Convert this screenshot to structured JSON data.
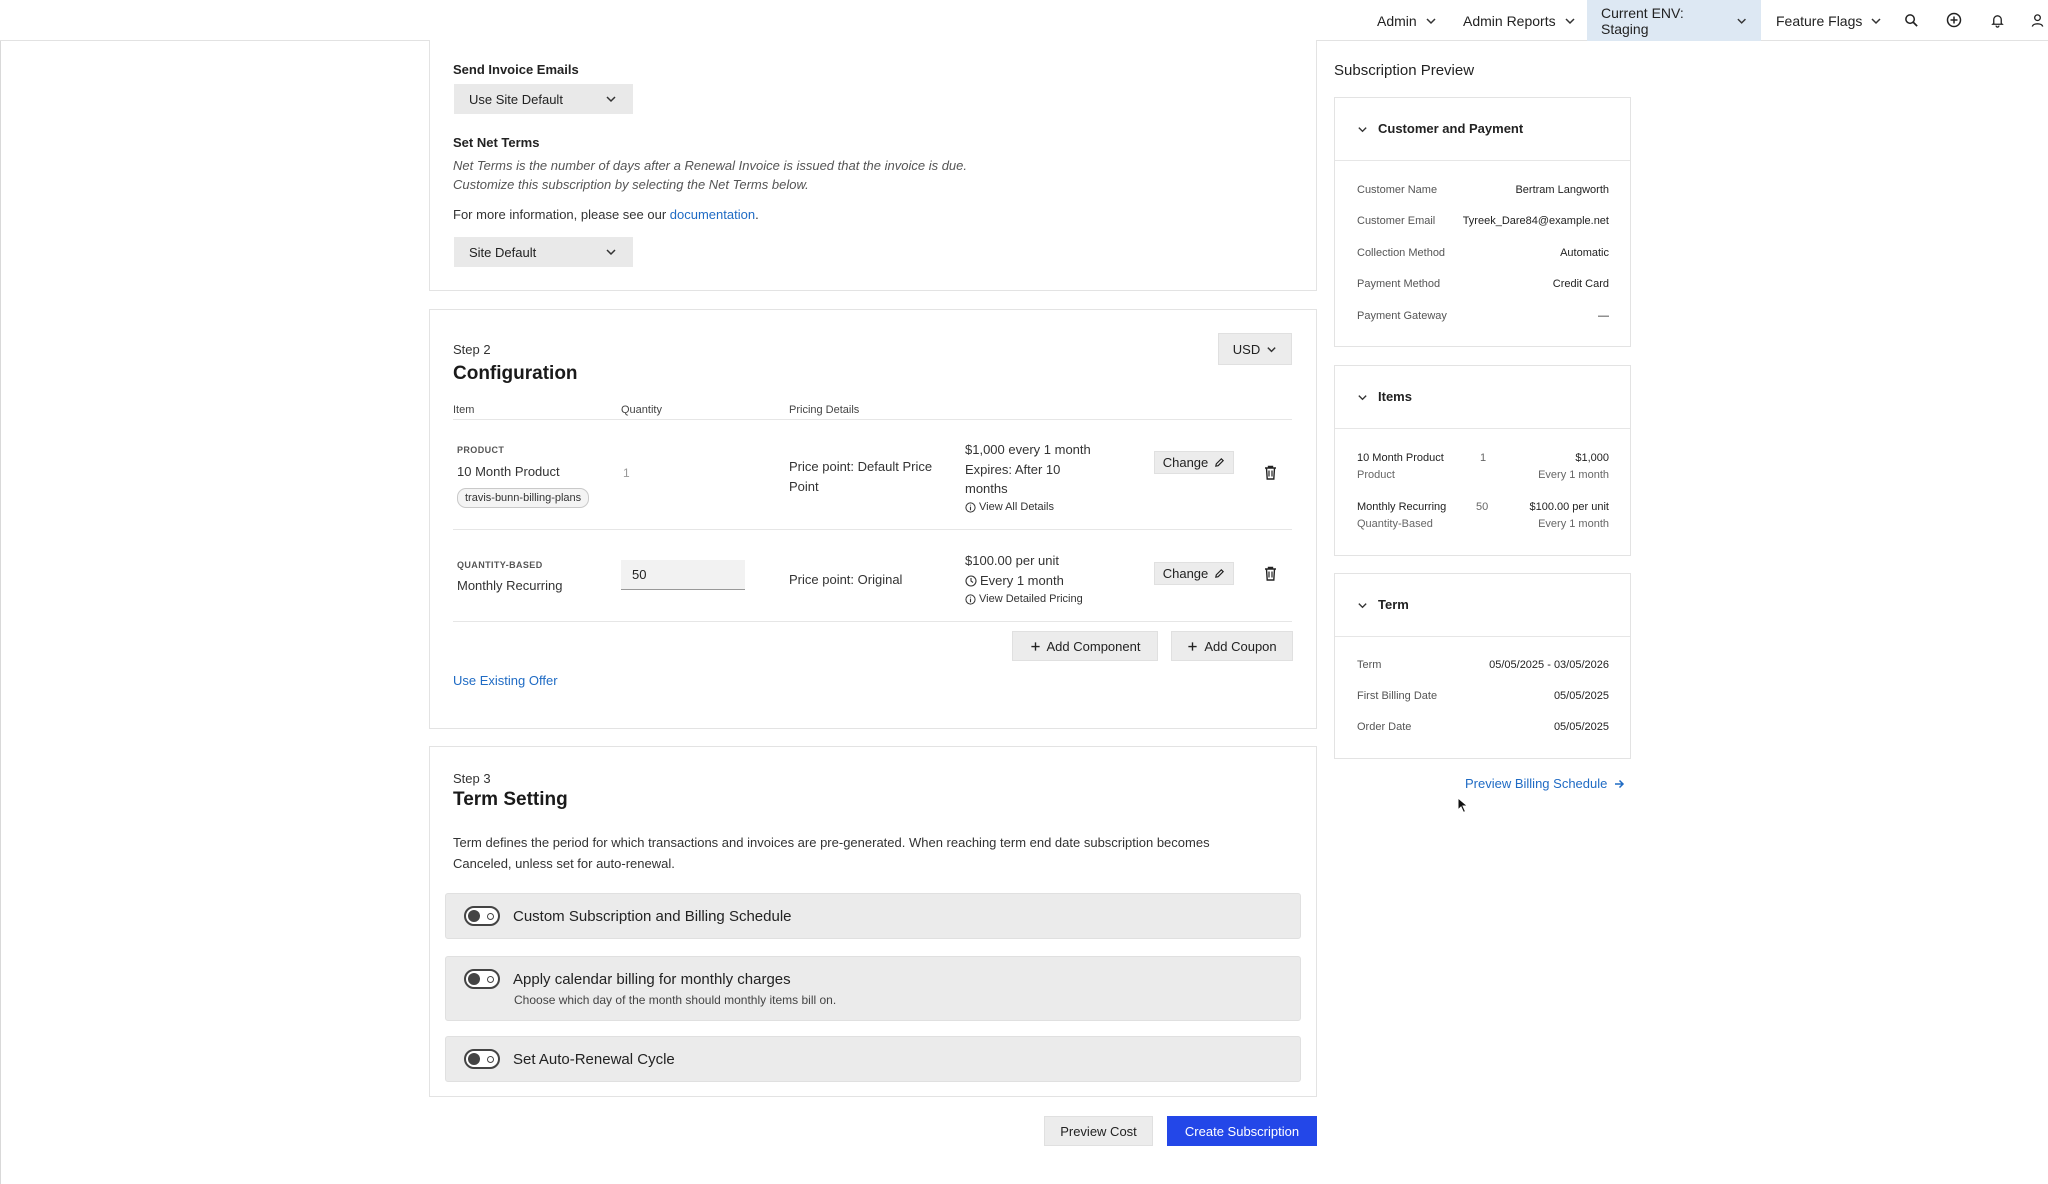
{
  "nav": {
    "admin": "Admin",
    "admin_reports": "Admin Reports",
    "env": "Current ENV: Staging",
    "feature_flags": "Feature Flags"
  },
  "billing": {
    "send_invoice_label": "Send Invoice Emails",
    "send_invoice_value": "Use Site Default",
    "net_terms_label": "Set Net Terms",
    "net_terms_desc_1": "Net Terms is the number of days after a Renewal Invoice is issued that the invoice is due.",
    "net_terms_desc_2": "Customize this subscription by selecting the Net Terms below.",
    "more_info_prefix": "For more information, please see our",
    "documentation_link": "documentation",
    "more_info_suffix": ".",
    "net_terms_value": "Site Default"
  },
  "config": {
    "step": "Step 2",
    "title": "Configuration",
    "currency": "USD",
    "col_item": "Item",
    "col_quantity": "Quantity",
    "col_pricing": "Pricing Details",
    "row1": {
      "type": "PRODUCT",
      "name": "10 Month Product",
      "tag": "travis-bunn-billing-plans",
      "quantity": "1",
      "price_point_1": "Price point: Default Price",
      "price_point_2": "Point",
      "price_1": "$1,000 every 1 month",
      "expires_1": "Expires: After 10",
      "expires_2": "months",
      "details_link": "View All Details",
      "change": "Change"
    },
    "row2": {
      "type": "QUANTITY-BASED",
      "name": "Monthly Recurring",
      "quantity": "50",
      "price_point": "Price point: Original",
      "price": "$100.00 per unit",
      "frequency": "Every 1 month",
      "details_link": "View Detailed Pricing",
      "change": "Change"
    },
    "add_component": "Add Component",
    "add_coupon": "Add Coupon",
    "use_existing_offer": "Use Existing Offer"
  },
  "term_setting": {
    "step": "Step 3",
    "title": "Term Setting",
    "desc_1": "Term defines the period for which transactions and invoices are pre-generated. When reaching term end date subscription becomes",
    "desc_2": "Canceled, unless set for auto-renewal.",
    "toggle1": "Custom Subscription and Billing Schedule",
    "toggle2": "Apply calendar billing for monthly charges",
    "toggle2_sub": "Choose which day of the month should monthly items bill on.",
    "toggle3": "Set Auto-Renewal Cycle"
  },
  "actions": {
    "preview_cost": "Preview Cost",
    "create_subscription": "Create Subscription"
  },
  "preview": {
    "title": "Subscription Preview",
    "customer_section": "Customer and Payment",
    "customer_name_label": "Customer Name",
    "customer_name": "Bertram Langworth",
    "customer_email_label": "Customer Email",
    "customer_email": "Tyreek_Dare84@example.net",
    "collection_label": "Collection Method",
    "collection": "Automatic",
    "payment_method_label": "Payment Method",
    "payment_method": "Credit Card",
    "gateway_label": "Payment Gateway",
    "gateway": "—",
    "items_section": "Items",
    "item1_name": "10 Month Product",
    "item1_type": "Product",
    "item1_qty": "1",
    "item1_price": "$1,000",
    "item1_freq": "Every 1 month",
    "item2_name": "Monthly Recurring",
    "item2_type": "Quantity-Based",
    "item2_qty": "50",
    "item2_price": "$100.00 per unit",
    "item2_freq": "Every 1 month",
    "term_section": "Term",
    "term_label": "Term",
    "term": "05/05/2025 - 03/05/2026",
    "first_billing_label": "First Billing Date",
    "first_billing": "05/05/2025",
    "order_date_label": "Order Date",
    "order_date": "05/05/2025",
    "billing_schedule_link": "Preview Billing Schedule"
  }
}
